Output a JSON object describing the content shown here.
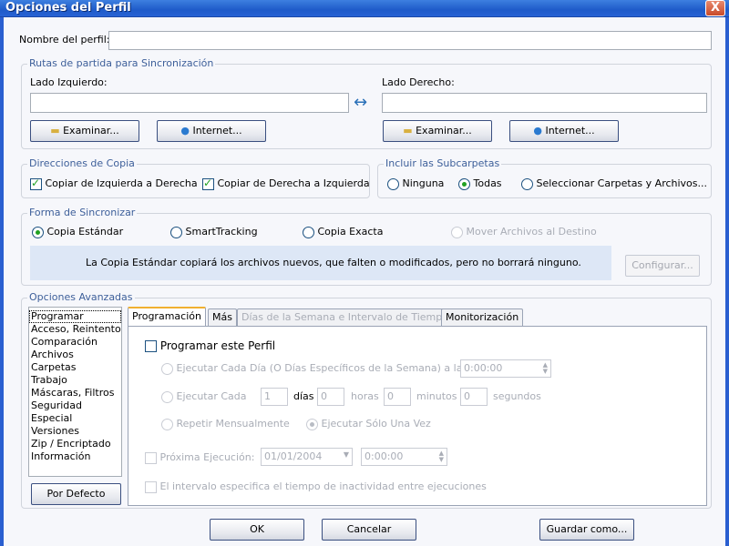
{
  "window": {
    "title": "Opciones del Perfil",
    "close_label": "X"
  },
  "profile_name": {
    "label": "Nombre del perfil:",
    "value": ""
  },
  "paths": {
    "legend": "Rutas de partida para Sincronización",
    "left_label": "Lado Izquierdo:",
    "right_label": "Lado Derecho:",
    "left_value": "",
    "right_value": "",
    "arrow": "↔",
    "browse": "Examinar...",
    "internet": "Internet..."
  },
  "copy_directions": {
    "legend": "Direcciones de Copia",
    "left_to_right": "Copiar de Izquierda a Derecha",
    "right_to_left": "Copiar de Derecha a Izquierda"
  },
  "subfolders": {
    "legend": "Incluir las Subcarpetas",
    "options": [
      "Ninguna",
      "Todas",
      "Seleccionar Carpetas y Archivos..."
    ],
    "selected": "Todas"
  },
  "sync_mode": {
    "legend": "Forma de Sincronizar",
    "options": [
      "Copia Estándar",
      "SmartTracking",
      "Copia Exacta",
      "Mover Archivos al Destino"
    ],
    "selected": "Copia Estándar",
    "description": "La Copia Estándar copiará los archivos nuevos, que falten o modificados, pero no borrará ninguno.",
    "configure": "Configurar..."
  },
  "advanced": {
    "legend": "Opciones Avanzadas",
    "list": [
      "Programar",
      "Acceso, Reintento",
      "Comparación",
      "Archivos",
      "Carpetas",
      "Trabajo",
      "Máscaras, Filtros",
      "Seguridad",
      "Especial",
      "Versiones",
      "Zip / Encriptado",
      "Información"
    ],
    "selected": "Programar",
    "default_button": "Por Defecto",
    "tabs": [
      "Programación",
      "Más",
      "Días de la Semana e Intervalo de Tiempo",
      "Monitorización"
    ],
    "active_tab": "Programación",
    "schedule": {
      "enable": "Programar este Perfil",
      "daily": "Ejecutar Cada Día (O Días Específicos de la Semana) a las",
      "daily_time": "0:00:00",
      "every": "Ejecutar Cada",
      "every_days": "1",
      "days": "días",
      "every_hours": "0",
      "hours": "horas",
      "every_minutes": "0",
      "minutes": "minutos",
      "every_seconds": "0",
      "seconds": "segundos",
      "monthly": "Repetir Mensualmente",
      "once": "Ejecutar Sólo Una Vez",
      "next_run": "Próxima Ejecución:",
      "next_date": "01/01/2004",
      "next_time": "0:00:00",
      "idle": "El intervalo especifica el tiempo de inactividad entre ejecuciones"
    }
  },
  "footer": {
    "ok": "OK",
    "cancel": "Cancelar",
    "save_as": "Guardar como..."
  },
  "colors": {
    "titlebar": "#1f5bc9",
    "accent": "#21a121"
  }
}
